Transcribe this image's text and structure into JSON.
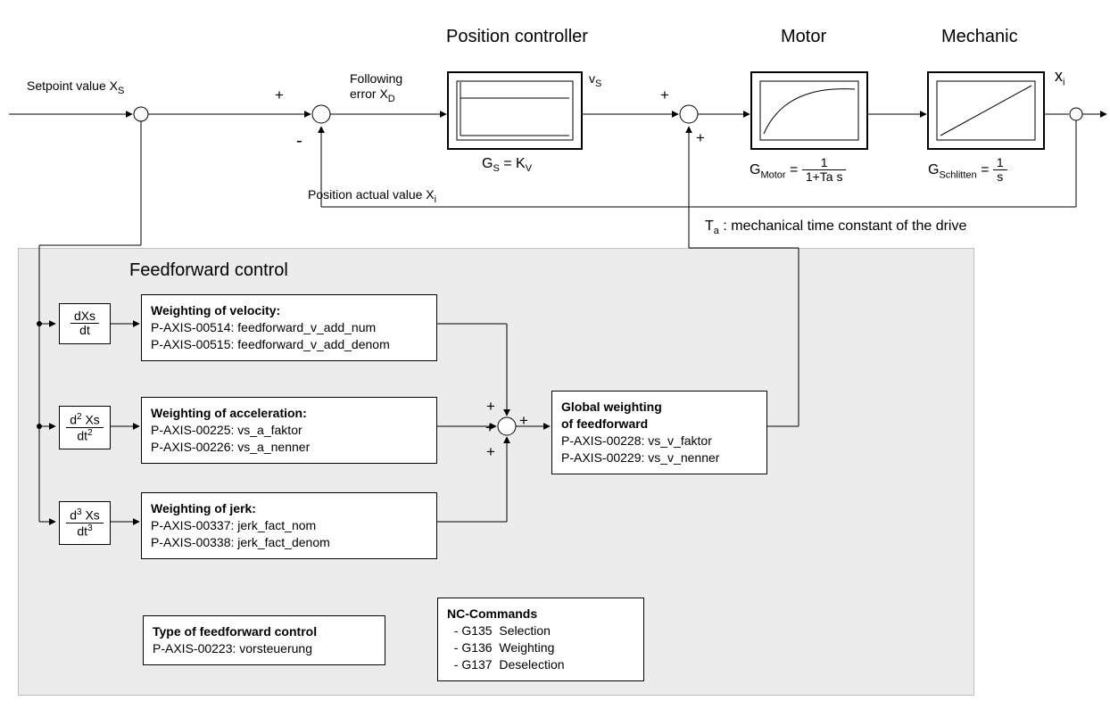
{
  "top": {
    "setpoint": "Setpoint value X",
    "setpoint_sub": "S",
    "following": "Following",
    "following2": "error X",
    "following_sub": "D",
    "pos_controller_title": "Position controller",
    "gs_eq": "G",
    "gs_sub": "S",
    "gs_rhs": " = K",
    "gs_rhs_sub": "V",
    "vs": "v",
    "vs_sub": "S",
    "motor_title": "Motor",
    "g_motor": "G",
    "g_motor_sub": "Motor",
    "g_motor_eq": " = ",
    "g_motor_num": "1",
    "g_motor_den": "1+Ta  s",
    "mechanic_title": "Mechanic",
    "g_schlitten": "G",
    "g_schlitten_sub": "Schlitten",
    "g_schlitten_eq": " = ",
    "g_schlitten_num": "1",
    "g_schlitten_den": "s",
    "xi": "x",
    "xi_sub": "i",
    "pos_actual": "Position actual value X",
    "pos_actual_sub": "i",
    "ta_note": "T",
    "ta_note_sub": "a",
    "ta_note_rest": " : mechanical time constant of the drive",
    "plus": "+",
    "minus": "-"
  },
  "ff": {
    "title": "Feedforward control",
    "deriv1_num": "dXs",
    "deriv1_den": "dt",
    "deriv2_num_pre": "d",
    "deriv2_num_exp": "2",
    "deriv2_num_post": " Xs",
    "deriv2_den_pre": "dt",
    "deriv2_den_exp": "2",
    "deriv3_num_pre": "d",
    "deriv3_num_exp": "3",
    "deriv3_num_post": " Xs",
    "deriv3_den_pre": "dt",
    "deriv3_den_exp": "3",
    "vel_title": "Weighting of  velocity:",
    "vel_l1": "P-AXIS-00514: feedforward_v_add_num",
    "vel_l2": "P-AXIS-00515: feedforward_v_add_denom",
    "acc_title": "Weighting of acceleration:",
    "acc_l1": "P-AXIS-00225: vs_a_faktor",
    "acc_l2": "P-AXIS-00226: vs_a_nenner",
    "jerk_title": "Weighting of jerk:",
    "jerk_l1": "P-AXIS-00337: jerk_fact_nom",
    "jerk_l2": "P-AXIS-00338: jerk_fact_denom",
    "global_title1": "Global weighting",
    "global_title2": "of feedforward",
    "global_l1": "P-AXIS-00228: vs_v_faktor",
    "global_l2": "P-AXIS-00229: vs_v_nenner",
    "type_title": "Type of feedforward control",
    "type_l1": "P-AXIS-00223: vorsteuerung",
    "nc_title": "NC-Commands",
    "nc_l1": "  - G135  Selection",
    "nc_l2": "  - G136  Weighting",
    "nc_l3": "  - G137  Deselection"
  }
}
